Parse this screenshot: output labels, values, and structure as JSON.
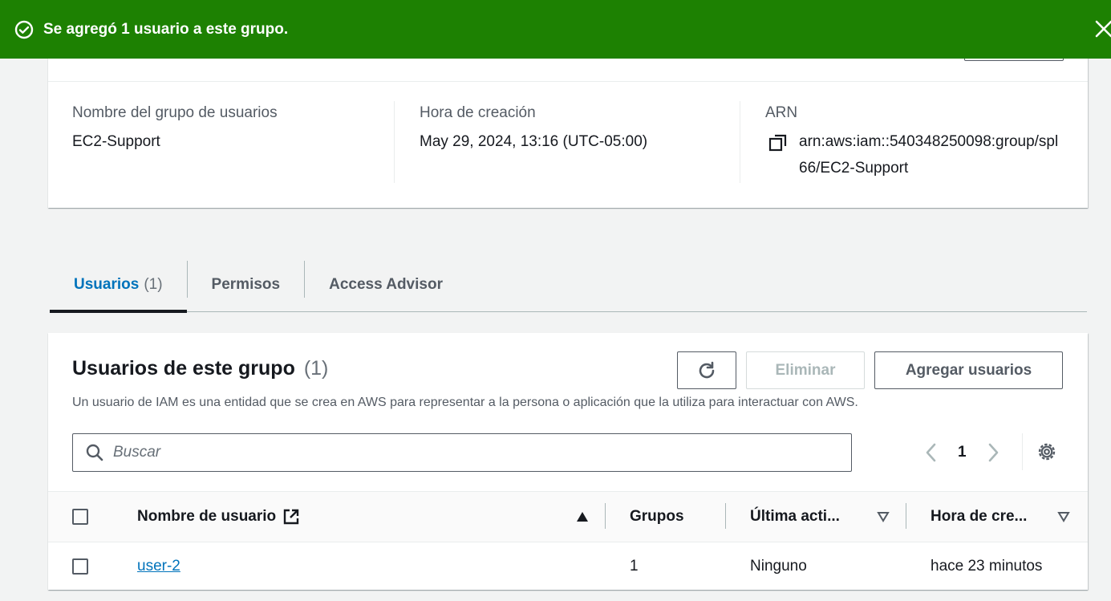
{
  "flash": {
    "message": "Se agregó 1 usuario a este grupo.",
    "color": "#1d8102"
  },
  "summary": {
    "name_label": "Nombre del grupo de usuarios",
    "name_value": "EC2-Support",
    "created_label": "Hora de creación",
    "created_value": "May 29, 2024, 13:16 (UTC-05:00)",
    "arn_label": "ARN",
    "arn_value": "arn:aws:iam::540348250098:group/spl66/EC2-Support"
  },
  "tabs": [
    {
      "label": "Usuarios",
      "count": "(1)",
      "active": true
    },
    {
      "label": "Permisos",
      "active": false
    },
    {
      "label": "Access Advisor",
      "active": false
    }
  ],
  "users_panel": {
    "title": "Usuarios de este grupo",
    "count": "(1)",
    "description": "Un usuario de IAM es una entidad que se crea en AWS para representar a la persona o aplicación que la utiliza para interactuar con AWS.",
    "delete_label": "Eliminar",
    "add_label": "Agregar usuarios",
    "search_placeholder": "Buscar",
    "page": "1",
    "columns": [
      "Nombre de usuario",
      "Grupos",
      "Última acti...",
      "Hora de cre..."
    ],
    "rows": [
      {
        "user": "user-2",
        "groups": "1",
        "last_activity": "Ninguno",
        "created": "hace 23 minutos"
      }
    ]
  },
  "colors": {
    "accent": "#0073bb",
    "success": "#1d8102",
    "text": "#16191f",
    "muted": "#545b64"
  }
}
